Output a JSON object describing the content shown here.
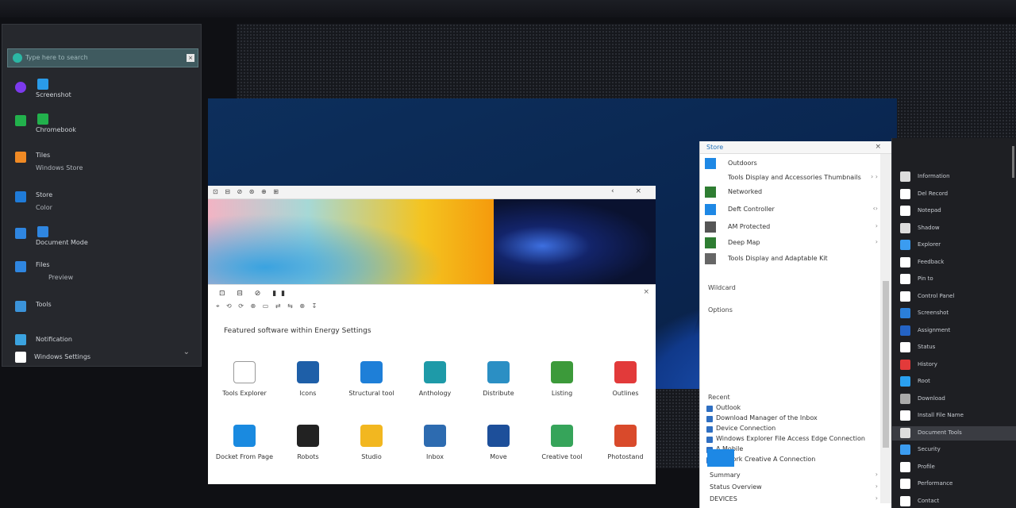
{
  "colors": {
    "accent": "#1d88e5",
    "wallpaper": "#0d2f5c",
    "start_menu_bg": "#26282d"
  },
  "start_menu": {
    "search_placeholder": "Type here to search",
    "close_icon": "close-icon",
    "items": [
      {
        "label": "Screenshot",
        "sub": "",
        "icon_color": "#2a9be8",
        "icon_color2": "#7c3aed"
      },
      {
        "label": "Chromebook",
        "sub": "",
        "icon_color": "#22b14c",
        "icon_color2": ""
      },
      {
        "label": "Tiles",
        "sub": "Windows Store",
        "icon_color": "#f08a24",
        "icon_color2": ""
      },
      {
        "label": "Store",
        "sub": "Color",
        "icon_color": "#1f7bd8",
        "icon_color2": ""
      },
      {
        "label": "Document Mode",
        "sub": "",
        "icon_color": "#2f86e0",
        "icon_color2": ""
      },
      {
        "label": "Files",
        "sub": "Preview",
        "icon_color": "#2f86e0",
        "icon_color2": ""
      },
      {
        "label": "Tools",
        "sub": "",
        "icon_color": "#3b93d9",
        "icon_color2": ""
      },
      {
        "label": "Notification",
        "sub": "",
        "icon_color": "#3ba3e0",
        "icon_color2": ""
      },
      {
        "label": "Windows Settings",
        "sub": "",
        "icon_color": "#ffffff",
        "icon_color2": ""
      }
    ]
  },
  "photos_window": {
    "toolbar": "⊡ ⊟ ⊘ ⊛ ⊕ ⊞",
    "controls": "‹ ×"
  },
  "apps_window": {
    "toolbar": "⊡ ⊟ ⊘ ▮▮",
    "toolbar2": "⌖ ⟲ ⟳ ⊕ ▭   ⇄ ⇆ ⊕ ↧",
    "close": "×",
    "heading": "Featured software within Energy Settings",
    "apps_row1": [
      {
        "label": "Tools Explorer",
        "icon": "calendar-icon",
        "color": "#ffffff"
      },
      {
        "label": "Icons",
        "icon": "image-icon",
        "color": "#1e5fa8"
      },
      {
        "label": "Structural tool",
        "icon": "edge-icon",
        "color": "#1e7fd8"
      },
      {
        "label": "Anthology",
        "icon": "teal-logo-icon",
        "color": "#1e9aa8"
      },
      {
        "label": "Distribute",
        "icon": "network-icon",
        "color": "#2b8fc4"
      },
      {
        "label": "Listing",
        "icon": "chat-icon",
        "color": "#3c9a3a"
      },
      {
        "label": "Outlines",
        "icon": "folder-icon",
        "color": "#e23a3a"
      }
    ],
    "apps_row2": [
      {
        "label": "Docket From Page",
        "icon": "cloud-icon",
        "color": "#1a8ae0"
      },
      {
        "label": "Robots",
        "icon": "robot-icon",
        "color": "#222222"
      },
      {
        "label": "Studio",
        "icon": "globe-icon",
        "color": "#f2b720"
      },
      {
        "label": "Inbox",
        "icon": "bag-icon",
        "color": "#2d6bb0"
      },
      {
        "label": "Move",
        "icon": "blue-square-icon",
        "color": "#1d4f9a"
      },
      {
        "label": "Creative tool",
        "icon": "swirl-icon",
        "color": "#36a45a"
      },
      {
        "label": "Photostand",
        "icon": "photo-icon",
        "color": "#d94a2b"
      }
    ]
  },
  "explorer": {
    "title": "Store",
    "close": "×",
    "rows": [
      {
        "label": "Outdoors",
        "icon_color": "#1e88e5",
        "chev": ""
      },
      {
        "label": "Tools Display and Accessories Thumbnails",
        "icon_color": "",
        "chev": "› ›"
      },
      {
        "label": "Networked",
        "icon_color": "#2e7d32",
        "chev": ""
      },
      {
        "label": "Deft Controller",
        "icon_color": "#1e88e5",
        "chev": "‹›"
      },
      {
        "label": "AM Protected",
        "icon_color": "#555555",
        "chev": "›"
      },
      {
        "label": "Deep Map",
        "icon_color": "#2e7d32",
        "chev": "›"
      },
      {
        "label": "Tools Display and Adaptable Kit",
        "icon_color": "#666666",
        "chev": ""
      }
    ],
    "extra1": "Wildcard",
    "extra2": "Options",
    "section": "Recent",
    "lower": [
      "Outlook",
      "Download Manager of the Inbox",
      "Device Connection",
      "Windows Explorer File Access Edge Connection",
      "A Mobile",
      "Network Creative A Connection"
    ],
    "footer": [
      {
        "label": "Summary",
        "chev": "›"
      },
      {
        "label": "Status Overview",
        "chev": "›"
      },
      {
        "label": "DEVICES",
        "chev": "›"
      }
    ]
  },
  "rightbar": {
    "items": [
      {
        "label": "Information",
        "icon_color": "#dddddd"
      },
      {
        "label": "Del Record",
        "icon_color": "#ffffff"
      },
      {
        "label": "Notepad",
        "icon_color": "#ffffff"
      },
      {
        "label": "Shadow",
        "icon_color": "#dddddd"
      },
      {
        "label": "Explorer",
        "icon_color": "#3b9cf0"
      },
      {
        "label": "Feedback",
        "icon_color": "#ffffff"
      },
      {
        "label": "Pin to",
        "icon_color": "#ffffff"
      },
      {
        "label": "Control Panel",
        "icon_color": "#ffffff"
      },
      {
        "label": "Screenshot",
        "icon_color": "#2b7fd8"
      },
      {
        "label": "Assignment",
        "icon_color": "#2463c4"
      },
      {
        "label": "Status",
        "icon_color": "#ffffff"
      },
      {
        "label": "History",
        "icon_color": "#e33a3a"
      },
      {
        "label": "Root",
        "icon_color": "#2aa0f0"
      },
      {
        "label": "Download",
        "icon_color": "#aaaaaa"
      },
      {
        "label": "Install File Name",
        "icon_color": "#ffffff"
      },
      {
        "label": "Document Tools",
        "icon_color": "#dddddd"
      },
      {
        "label": "Security",
        "icon_color": "#3b9cf0"
      },
      {
        "label": "Profile",
        "icon_color": "#ffffff"
      },
      {
        "label": "Performance",
        "icon_color": "#ffffff"
      },
      {
        "label": "Contact",
        "icon_color": "#ffffff"
      }
    ]
  }
}
